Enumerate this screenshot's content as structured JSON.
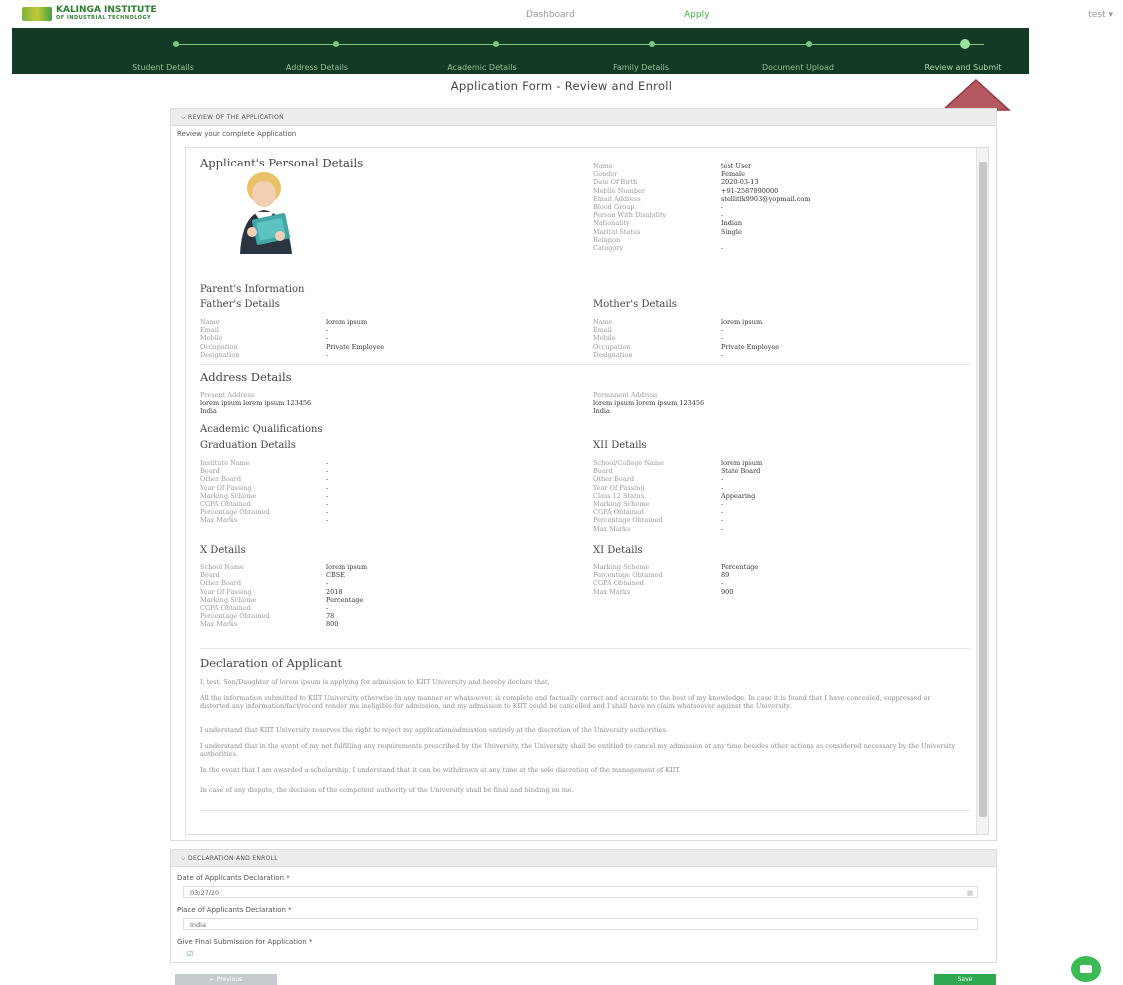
{
  "topbar": {
    "logo": {
      "name": "KALINGA INSTITUTE",
      "sub": "OF INDUSTRIAL TECHNOLOGY"
    },
    "nav": {
      "dashboard": "Dashboard",
      "apply": "Apply"
    },
    "user": "test ▾"
  },
  "stepper": {
    "steps": [
      "Student Details",
      "Address Details",
      "Academic Details",
      "Family Details",
      "Document Upload",
      "Review and Submit"
    ],
    "active_step": 6
  },
  "form_title": "Application Form - Review and Enroll",
  "review": {
    "heading": "⌵ REVIEW OF THE APPLICATION",
    "subtitle": "Review your complete Application",
    "personal": {
      "title": "Applicant's Personal Details",
      "fields": [
        {
          "k": "Name",
          "v": "test User"
        },
        {
          "k": "Gender",
          "v": "Female"
        },
        {
          "k": "Date Of Birth",
          "v": "2020-03-13"
        },
        {
          "k": "Mobile Number",
          "v": "+91-2587890000"
        },
        {
          "k": "Email Address",
          "v": "stellitik9903@yopmail.com"
        },
        {
          "k": "Blood Group",
          "v": "-"
        },
        {
          "k": "Person With Disability",
          "v": "-"
        },
        {
          "k": "Nationality",
          "v": "Indian"
        },
        {
          "k": "Marital Status",
          "v": "Single"
        },
        {
          "k": "Religion",
          "v": ""
        },
        {
          "k": "Category",
          "v": "-"
        }
      ]
    },
    "parents": {
      "title": "Parent's Information",
      "father": {
        "title": "Father's Details",
        "fields": [
          {
            "k": "Name",
            "v": "lorem ipsum"
          },
          {
            "k": "Email",
            "v": "-"
          },
          {
            "k": "Mobile",
            "v": "-"
          },
          {
            "k": "Occupation",
            "v": "Private Employee"
          },
          {
            "k": "Designation",
            "v": "-"
          }
        ]
      },
      "mother": {
        "title": "Mother's Details",
        "fields": [
          {
            "k": "Name",
            "v": "lorem ipsum"
          },
          {
            "k": "Email",
            "v": "-"
          },
          {
            "k": "Mobile",
            "v": "-"
          },
          {
            "k": "Occupation",
            "v": "Private Employee"
          },
          {
            "k": "Designation",
            "v": "-"
          }
        ]
      }
    },
    "address": {
      "title": "Address Details",
      "present": {
        "label": "Present Address",
        "line1": "lorem ipsum lorem ipsum 123456",
        "line2": "India"
      },
      "permanent": {
        "label": "Permanent Address",
        "line1": "lorem ipsum lorem ipsum 123456",
        "line2": "India"
      }
    },
    "academic": {
      "title": "Academic Qualifications",
      "graduation": {
        "title": "Graduation Details",
        "fields": [
          {
            "k": "Institute Name",
            "v": "-"
          },
          {
            "k": "Board",
            "v": "-"
          },
          {
            "k": "Other Board",
            "v": "-"
          },
          {
            "k": "Year Of Passing",
            "v": "-"
          },
          {
            "k": "Marking Scheme",
            "v": "-"
          },
          {
            "k": "CGPA Obtained",
            "v": "-"
          },
          {
            "k": "Percentage Obtained",
            "v": "-"
          },
          {
            "k": "Max Marks",
            "v": "-"
          }
        ]
      },
      "xii": {
        "title": "XII Details",
        "fields": [
          {
            "k": "School/College Name",
            "v": "lorem ipsum"
          },
          {
            "k": "Board",
            "v": "State Board"
          },
          {
            "k": "Other Board",
            "v": "-"
          },
          {
            "k": "Year Of Passing",
            "v": "-"
          },
          {
            "k": "Class 12 Status",
            "v": "Appearing"
          },
          {
            "k": "Marking Scheme",
            "v": "-"
          },
          {
            "k": "CGPA Obtained",
            "v": "-"
          },
          {
            "k": "Percentage Obtained",
            "v": "-"
          },
          {
            "k": "Max Marks",
            "v": "-"
          }
        ]
      },
      "x": {
        "title": "X Details",
        "fields": [
          {
            "k": "School Name",
            "v": "lorem ipsum"
          },
          {
            "k": "Board",
            "v": "CBSE"
          },
          {
            "k": "Other Board",
            "v": "-"
          },
          {
            "k": "Year Of Passing",
            "v": "2018"
          },
          {
            "k": "Marking Scheme",
            "v": "Percentage"
          },
          {
            "k": "CGPA Obtained",
            "v": "-"
          },
          {
            "k": "Percentage Obtained",
            "v": "78"
          },
          {
            "k": "Max Marks",
            "v": "800"
          }
        ]
      },
      "xi": {
        "title": "XI Details",
        "fields": [
          {
            "k": "Marking Scheme",
            "v": "Percentage"
          },
          {
            "k": "Percentage Obtained",
            "v": "89"
          },
          {
            "k": "CGPA Obtained",
            "v": "-"
          },
          {
            "k": "Max Marks",
            "v": "900"
          }
        ]
      }
    },
    "declaration": {
      "title": "Declaration of Applicant",
      "paragraphs": [
        "I, test, Son/Daughter of lorem ipsum is applying for admission to KIIT University and hereby declare that,",
        "All the information submitted to KIIT University otherwise in any manner or whatsoever, is complete and factually correct and accurate to the best of my knowledge. In case it is found that I have concealed, suppressed or distorted any information/fact/record render me ineligible for admission, and my admission to KIIT could be cancelled and I shall have no claim whatsoever against the University.",
        "I understand that KIIT University reserves the right to reject my application/admission entirely at the discretion of the University authorities.",
        "I understand that in the event of my not fulfilling any requirements prescribed by the University, the University shall be entitled to cancel my admission at any time besides other actions as considered necessary by the University authorities.",
        "In the event that I am awarded a scholarship, I understand that it can be withdrawn at any time at the sole discretion of the management of KIIT.",
        "In case of any dispute, the decision of the competent authority of the University shall be final and binding on me."
      ]
    }
  },
  "enroll": {
    "heading": "⌵ DECLARATION AND ENROLL",
    "date_label": "Date of Applicants Declaration *",
    "date_value": "03/27/20",
    "place_label": "Place of Applicants Declaration *",
    "place_value": "India",
    "final_label": "Give Final Submission for Application *",
    "final_checked": "☑"
  },
  "buttons": {
    "previous": "← Previous",
    "save": "Save"
  },
  "colors": {
    "stepper_bg": "#123a24",
    "accent": "#4caf50",
    "arrow": "#b5585f"
  },
  "icons": {
    "photo": "student-photo",
    "chat": "chat-icon",
    "calendar": "calendar-icon"
  }
}
